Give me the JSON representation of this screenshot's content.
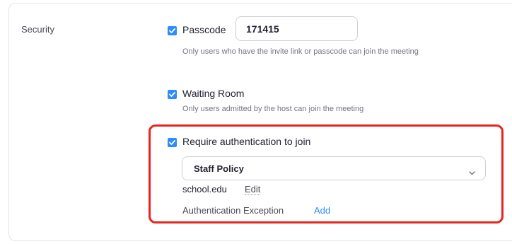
{
  "section": {
    "label": "Security"
  },
  "passcode": {
    "label": "Passcode",
    "checked": true,
    "value": "171415",
    "hint": "Only users who have the invite link or passcode can join the meeting"
  },
  "waiting_room": {
    "label": "Waiting Room",
    "checked": true,
    "hint": "Only users admitted by the host can join the meeting"
  },
  "authentication": {
    "label": "Require authentication to join",
    "checked": true,
    "selected_option": "Staff Policy",
    "domain": "school.edu",
    "edit_label": "Edit",
    "exception_label": "Authentication Exception",
    "add_label": "Add"
  },
  "colors": {
    "accent": "#2d8cff",
    "highlight": "#e8251d"
  },
  "icons": {
    "checkbox": "checkmark-icon",
    "dropdown": "chevron-down-icon"
  }
}
